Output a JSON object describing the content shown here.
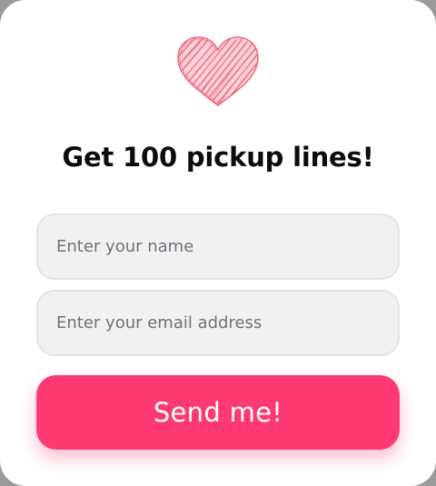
{
  "heading": "Get 100 pickup lines!",
  "form": {
    "name_placeholder": "Enter your name",
    "email_placeholder": "Enter your email address",
    "submit_label": "Send me!"
  },
  "icon": "heart-icon",
  "colors": {
    "accent": "#ff3a72",
    "heart": "#f07a8c",
    "field_bg": "#f1f1f1",
    "field_border": "#e3e3e3",
    "heading": "#0c0c0c",
    "placeholder": "#70717a"
  }
}
